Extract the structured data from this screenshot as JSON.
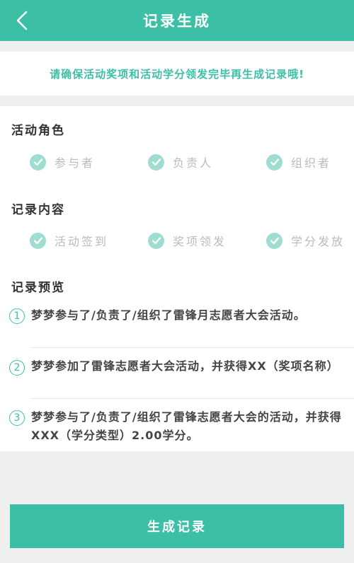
{
  "header": {
    "title": "记录生成",
    "back_icon": "chevron-left-icon"
  },
  "notice": {
    "text": "请确保活动奖项和活动学分领发完毕再生成记录哦!"
  },
  "role_section": {
    "title": "活动角色",
    "options": [
      {
        "label": "参与者",
        "checked": true
      },
      {
        "label": "负责人",
        "checked": true
      },
      {
        "label": "组织者",
        "checked": true
      }
    ]
  },
  "content_section": {
    "title": "记录内容",
    "options": [
      {
        "label": "活动签到",
        "checked": true
      },
      {
        "label": "奖项领发",
        "checked": true
      },
      {
        "label": "学分发放",
        "checked": true
      }
    ]
  },
  "preview_section": {
    "title": "记录预览",
    "items": [
      {
        "num": "1",
        "text": "梦梦参与了/负责了/组织了雷锋月志愿者大会活动。"
      },
      {
        "num": "2",
        "text": "梦梦参加了雷锋志愿者大会活动，并获得XX（奖项名称）"
      },
      {
        "num": "3",
        "text": "梦梦参与了/负责了/组织了雷锋志愿者大会的活动，并获得XXX（学分类型）2.00学分。"
      }
    ]
  },
  "generate_button": {
    "label": "生成记录"
  },
  "colors": {
    "accent": "#3dbfa6",
    "check_bg": "#9fddd1",
    "background": "#efefef"
  }
}
